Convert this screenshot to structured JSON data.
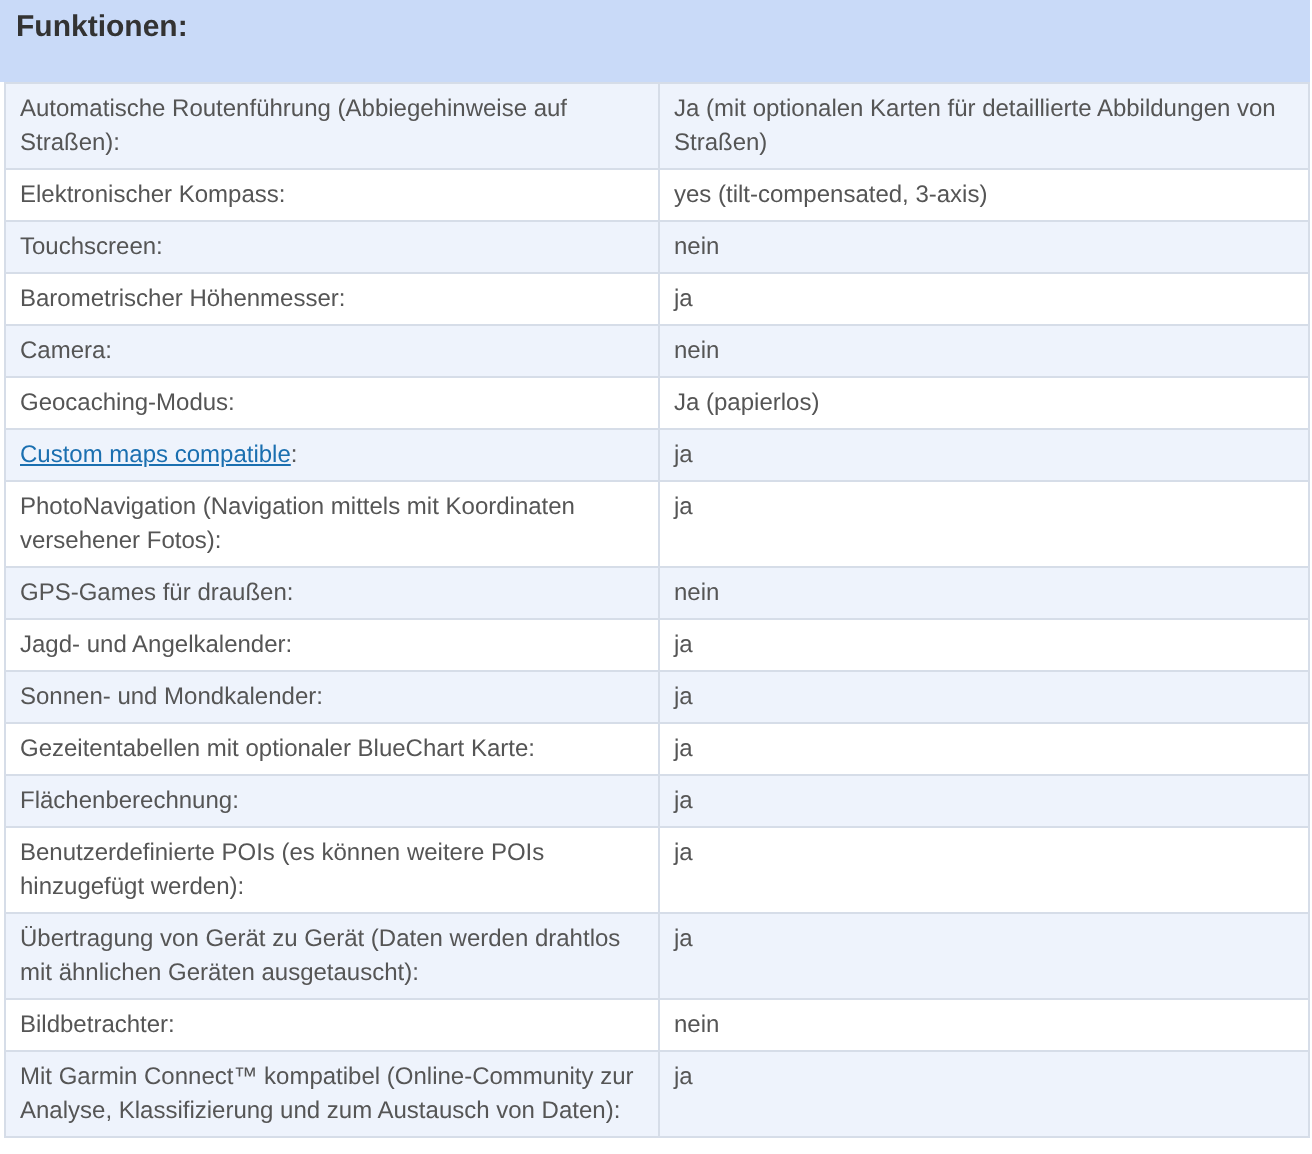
{
  "heading": "Funktionen:",
  "rows": [
    {
      "label": "Automatische Routenführung (Abbiegehinweise auf Straßen):",
      "value": "Ja (mit optionalen Karten für detaillierte Abbildungen von Straßen)"
    },
    {
      "label": "Elektronischer Kompass:",
      "value": "yes (tilt-compensated, 3-axis)"
    },
    {
      "label": "Touchscreen:",
      "value": "nein"
    },
    {
      "label": "Barometrischer Höhenmesser:",
      "value": "ja"
    },
    {
      "label": "Camera:",
      "value": "nein"
    },
    {
      "label": "Geocaching-Modus:",
      "value": "Ja (papierlos)"
    },
    {
      "link": "Custom maps compatible",
      "label": ":",
      "value": "ja"
    },
    {
      "label": "PhotoNavigation (Navigation mittels mit Koordinaten versehener Fotos):",
      "value": "ja"
    },
    {
      "label": "GPS-Games für draußen:",
      "value": "nein"
    },
    {
      "label": "Jagd- und Angelkalender:",
      "value": "ja"
    },
    {
      "label": "Sonnen- und Mondkalender:",
      "value": "ja"
    },
    {
      "label": "Gezeitentabellen mit optionaler BlueChart Karte:",
      "value": "ja"
    },
    {
      "label": "Flächenberechnung:",
      "value": "ja"
    },
    {
      "label": "Benutzerdefinierte POIs (es können weitere POIs hinzugefügt werden):",
      "value": "ja"
    },
    {
      "label": "Übertragung von Gerät zu Gerät (Daten werden drahtlos mit ähnlichen Geräten ausgetauscht):",
      "value": "ja"
    },
    {
      "label": "Bildbetrachter:",
      "value": "nein"
    },
    {
      "label": "Mit Garmin Connect™ kompatibel (Online-Community zur Analyse, Klassifizierung und zum Austausch von Daten):",
      "value": "ja"
    }
  ]
}
